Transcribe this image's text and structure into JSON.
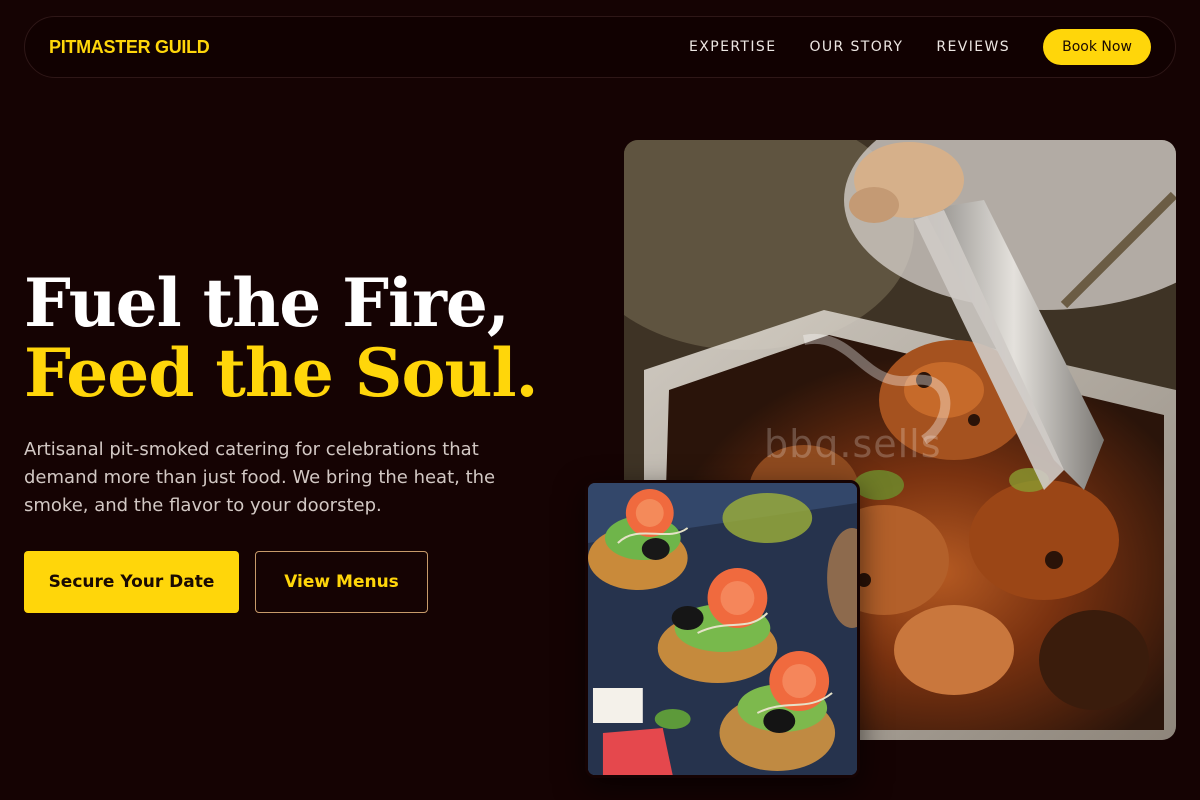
{
  "nav": {
    "brand": "PITMASTER GUILD",
    "links": [
      "EXPERTISE",
      "OUR STORY",
      "REVIEWS"
    ],
    "cta": "Book Now"
  },
  "hero": {
    "title_line1": "Fuel the Fire,",
    "title_line2": "Feed the Soul.",
    "subtitle": "Artisanal pit-smoked catering for celebrations that demand more than just food. We bring the heat, the smoke, and the flavor to your doorstep.",
    "primary_button": "Secure Your Date",
    "secondary_button": "View Menus"
  },
  "images": {
    "main_watermark": "bbq.sells",
    "main_alt": "Smoked meat being lifted with tongs from a tray",
    "secondary_alt": "Smoked salmon crostini appetizers"
  },
  "colors": {
    "background": "#150303",
    "accent": "#ffd60a",
    "text": "#ffffff",
    "muted_text": "#d2c8c4"
  }
}
